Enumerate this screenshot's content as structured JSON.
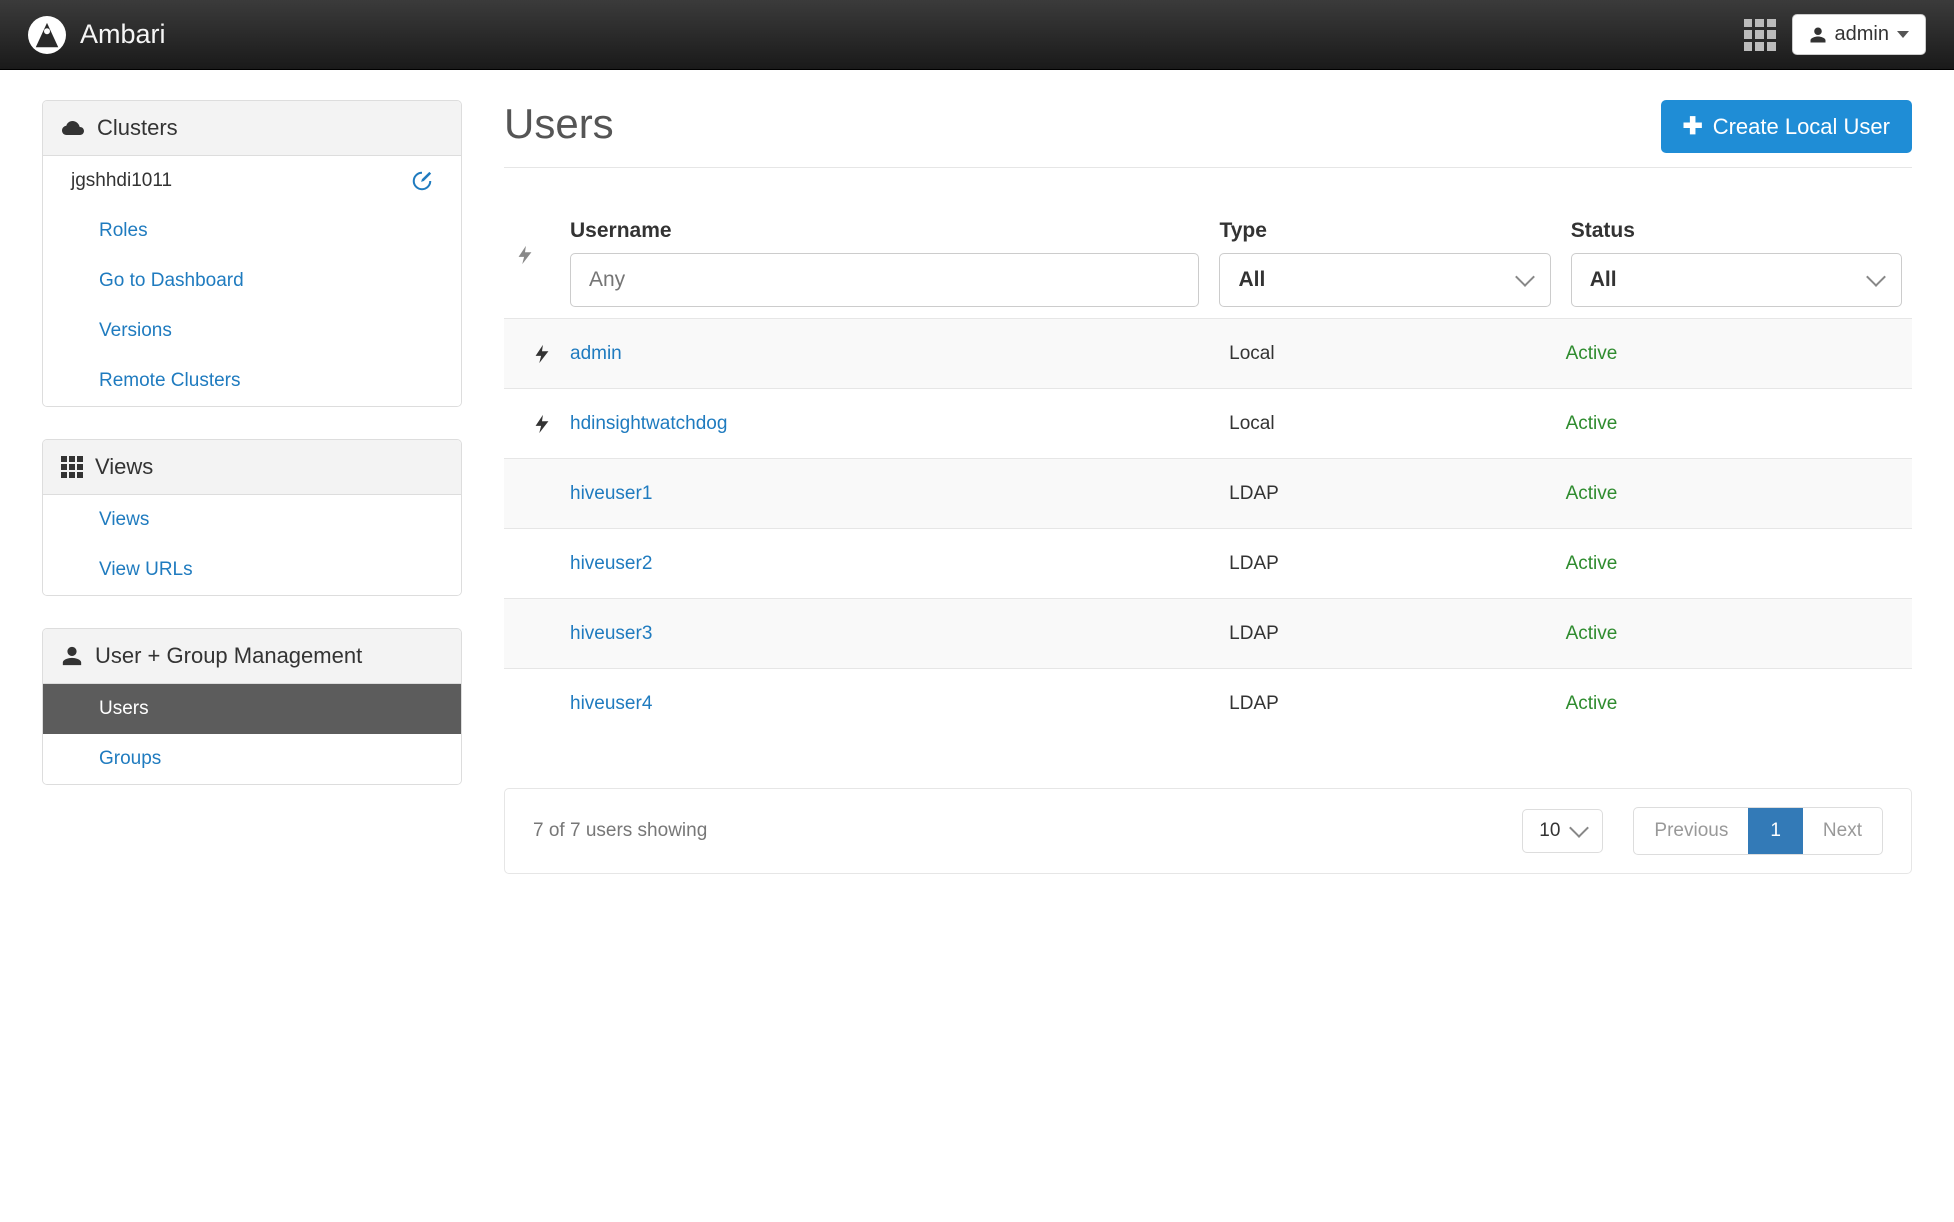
{
  "navbar": {
    "brand": "Ambari",
    "user_label": "admin"
  },
  "sidebar": {
    "clusters": {
      "header": "Clusters",
      "cluster_name": "jgshhdi1011",
      "roles_label": "Roles",
      "dashboard_label": "Go to Dashboard",
      "versions_label": "Versions",
      "remote_label": "Remote Clusters"
    },
    "views": {
      "header": "Views",
      "views_label": "Views",
      "view_urls_label": "View URLs"
    },
    "ugm": {
      "header": "User + Group Management",
      "users_label": "Users",
      "groups_label": "Groups"
    }
  },
  "main": {
    "title": "Users",
    "create_label": "Create Local User",
    "columns": {
      "username": "Username",
      "type": "Type",
      "status": "Status"
    },
    "filters": {
      "username_placeholder": "Any",
      "type_selected": "All",
      "status_selected": "All"
    },
    "rows": [
      {
        "admin": true,
        "username": "admin",
        "type": "Local",
        "status": "Active"
      },
      {
        "admin": true,
        "username": "hdinsightwatchdog",
        "type": "Local",
        "status": "Active"
      },
      {
        "admin": false,
        "username": "hiveuser1",
        "type": "LDAP",
        "status": "Active"
      },
      {
        "admin": false,
        "username": "hiveuser2",
        "type": "LDAP",
        "status": "Active"
      },
      {
        "admin": false,
        "username": "hiveuser3",
        "type": "LDAP",
        "status": "Active"
      },
      {
        "admin": false,
        "username": "hiveuser4",
        "type": "LDAP",
        "status": "Active"
      }
    ],
    "footer": {
      "status_text": "7 of 7 users showing",
      "page_size": "10",
      "prev_label": "Previous",
      "current_page": "1",
      "next_label": "Next"
    }
  }
}
